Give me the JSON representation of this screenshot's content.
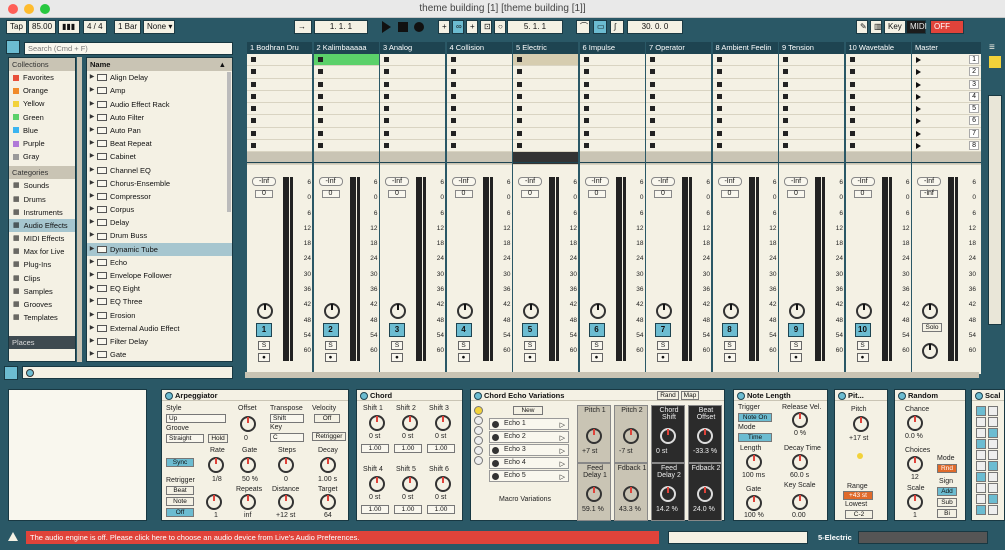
{
  "window": {
    "title": "theme building [1]  [theme building [1]]"
  },
  "control_bar": {
    "tap": "Tap",
    "tempo": "85.00",
    "time_sig": "4 / 4",
    "metro": "1 Bar",
    "quantize": "None",
    "position": "1. 1. 1",
    "loop_start": "5. 1. 1",
    "loop_len": "30. 0. 0",
    "key": "Key",
    "midi": "MIDI",
    "cpu": "OFF"
  },
  "search": {
    "placeholder": "Search (Cmd + F)"
  },
  "sidebar": {
    "collections_title": "Collections",
    "collections": [
      {
        "label": "Favorites",
        "color": "#e8503a"
      },
      {
        "label": "Orange",
        "color": "#f08a2a"
      },
      {
        "label": "Yellow",
        "color": "#f2d23a"
      },
      {
        "label": "Green",
        "color": "#5bd16a"
      },
      {
        "label": "Blue",
        "color": "#3ab4f0"
      },
      {
        "label": "Purple",
        "color": "#b07ad8"
      },
      {
        "label": "Gray",
        "color": "#9a9a9a"
      }
    ],
    "categories_title": "Categories",
    "categories": [
      "Sounds",
      "Drums",
      "Instruments",
      "Audio Effects",
      "MIDI Effects",
      "Max for Live",
      "Plug-Ins",
      "Clips",
      "Samples",
      "Grooves",
      "Templates"
    ],
    "places_title": "Places"
  },
  "filelist": {
    "header": "Name",
    "items": [
      "Align Delay",
      "Amp",
      "Audio Effect Rack",
      "Auto Filter",
      "Auto Pan",
      "Beat Repeat",
      "Cabinet",
      "Channel EQ",
      "Chorus-Ensemble",
      "Compressor",
      "Corpus",
      "Delay",
      "Drum Buss",
      "Dynamic Tube",
      "Echo",
      "Envelope Follower",
      "EQ Eight",
      "EQ Three",
      "Erosion",
      "External Audio Effect",
      "Filter Delay",
      "Gate"
    ]
  },
  "tracks": [
    {
      "name": "1 Bodhran Dru",
      "num": "1",
      "vol": "-Inf",
      "pan": "0"
    },
    {
      "name": "2 Kalimbaaaaa",
      "num": "2",
      "vol": "-Inf",
      "pan": "0"
    },
    {
      "name": "3 Analog",
      "num": "3",
      "vol": "-Inf",
      "pan": "0"
    },
    {
      "name": "4 Collision",
      "num": "4",
      "vol": "-Inf",
      "pan": "0"
    },
    {
      "name": "5 Electric",
      "num": "5",
      "vol": "-Inf",
      "pan": "0"
    },
    {
      "name": "6 Impulse",
      "num": "6",
      "vol": "-Inf",
      "pan": "0"
    },
    {
      "name": "7 Operator",
      "num": "7",
      "vol": "-Inf",
      "pan": "0"
    },
    {
      "name": "8 Ambient Feelin",
      "num": "8",
      "vol": "-Inf",
      "pan": "0"
    },
    {
      "name": "9 Tension",
      "num": "9",
      "vol": "-Inf",
      "pan": "0"
    },
    {
      "name": "10 Wavetable",
      "num": "10",
      "vol": "-Inf",
      "pan": "0"
    }
  ],
  "master": {
    "name": "Master",
    "vol": "-Inf",
    "pan": "-inf",
    "solo": "Solo",
    "scenes": [
      "1",
      "2",
      "3",
      "4",
      "5",
      "6",
      "7",
      "8"
    ]
  },
  "meter_scale": [
    "6",
    "0",
    "6",
    "12",
    "18",
    "24",
    "30",
    "36",
    "42",
    "48",
    "54",
    "60"
  ],
  "devices": {
    "arp": {
      "title": "Arpeggiator",
      "style": "Style",
      "style_val": "Up",
      "groove": "Groove",
      "groove_val": "Straight",
      "hold": "Hold",
      "offset": "Offset",
      "offset_val": "0",
      "transpose": "Transpose",
      "transpose_val": "Shift",
      "key": "Key",
      "key_val": "C",
      "velocity": "Velocity",
      "vel_val": "Off",
      "retrig_btn": "Retrigger",
      "sync": "Sync",
      "rate": "Rate",
      "rate_val": "1/8",
      "gate": "Gate",
      "gate_val": "50 %",
      "steps": "Steps",
      "steps_val": "0",
      "decay": "Decay",
      "decay_val": "1.00 s",
      "retrigger": "Retrigger",
      "beat": "Beat",
      "note": "Note",
      "off": "Off",
      "repeats": "Repeats",
      "repeats_val": "inf",
      "distance": "Distance",
      "distance_val": "+12 st",
      "target": "Target",
      "target_val": "64",
      "one": "1"
    },
    "chord": {
      "title": "Chord",
      "shifts": [
        "Shift 1",
        "Shift 2",
        "Shift 3",
        "Shift 4",
        "Shift 5",
        "Shift 6"
      ],
      "vals": [
        "0 st",
        "0 st",
        "0 st",
        "0 st",
        "0 st",
        "0 st"
      ],
      "vels": [
        "1.00",
        "1.00",
        "1.00",
        "1.00",
        "1.00",
        "1.00"
      ]
    },
    "rack": {
      "title": "Chord Echo Variations",
      "rand": "Rand",
      "map": "Map",
      "new": "New",
      "chains": [
        "Echo 1",
        "Echo 2",
        "Echo 3",
        "Echo 4",
        "Echo 5"
      ],
      "macro": "Macro Variations",
      "macros": [
        {
          "l": "Pitch 1",
          "v": "+7 st"
        },
        {
          "l": "Pitch 2",
          "v": "-7 st"
        },
        {
          "l": "Chord Shift",
          "v": "0 st"
        },
        {
          "l": "Beat Offset",
          "v": "-33.3 %"
        },
        {
          "l": "Feed Delay 1",
          "v": "59.1 %"
        },
        {
          "l": "Fdback 1",
          "v": "43.3 %"
        },
        {
          "l": "Feed Delay 2",
          "v": "14.2 %"
        },
        {
          "l": "Fdback 2",
          "v": "24.0 %"
        }
      ]
    },
    "notelen": {
      "title": "Note Length",
      "trigger": "Trigger",
      "trig_val": "Note On",
      "mode": "Mode",
      "mode_val": "Time",
      "length": "Length",
      "length_val": "100 ms",
      "gate": "Gate",
      "gate_val": "100 %",
      "rel": "Release Vel.",
      "rel_val": "0 %",
      "decay": "Decay Time",
      "decay_val": "60.0 s",
      "keyscale": "Key Scale",
      "keyscale_val": "0.00"
    },
    "pitch": {
      "title": "Pit...",
      "pitch": "Pitch",
      "pitch_val": "+17 st",
      "range": "Range",
      "range_val": "+43 st",
      "lowest": "Lowest",
      "lowest_val": "C-2"
    },
    "random": {
      "title": "Random",
      "chance": "Chance",
      "chance_val": "0.0 %",
      "choices": "Choices",
      "choices_val": "12",
      "scale": "Scale",
      "scale_val": "1",
      "mode": "Mode",
      "rnd": "Rnd",
      "sign": "Sign",
      "add": "Add",
      "sub": "Sub",
      "bi": "Bi"
    },
    "scale": {
      "title": "Scal"
    }
  },
  "status": {
    "message": "The audio engine is off. Please click here to choose an audio device from Live's Audio Preferences.",
    "track": "5-Electric"
  }
}
